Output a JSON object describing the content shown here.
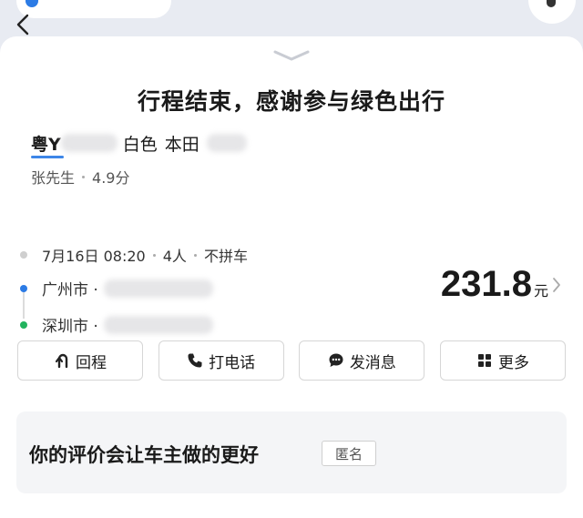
{
  "header": {
    "back_icon": "chevron-left-icon"
  },
  "sheet": {
    "title": "行程结束，感谢参与绿色出行"
  },
  "vehicle": {
    "plate_prefix": "粤Y",
    "color": "白色",
    "model": "本田"
  },
  "driver": {
    "name": "张先生",
    "rating": "4.9分"
  },
  "trip": {
    "date_time": "7月16日 08:20",
    "passengers": "4人",
    "carpool": "不拼车",
    "from_city": "广州市 ·",
    "to_city": "深圳市 ·"
  },
  "price": {
    "amount": "231.8",
    "unit": "元"
  },
  "actions": [
    {
      "label": "回程",
      "icon": "return-icon"
    },
    {
      "label": "打电话",
      "icon": "phone-icon"
    },
    {
      "label": "发消息",
      "icon": "message-icon"
    },
    {
      "label": "更多",
      "icon": "grid-icon"
    }
  ],
  "review": {
    "prompt": "你的评价会让车主做的更好",
    "anonymous_label": "匿名"
  },
  "colors": {
    "accent_blue": "#2c7be5",
    "route_green": "#22b35e"
  }
}
